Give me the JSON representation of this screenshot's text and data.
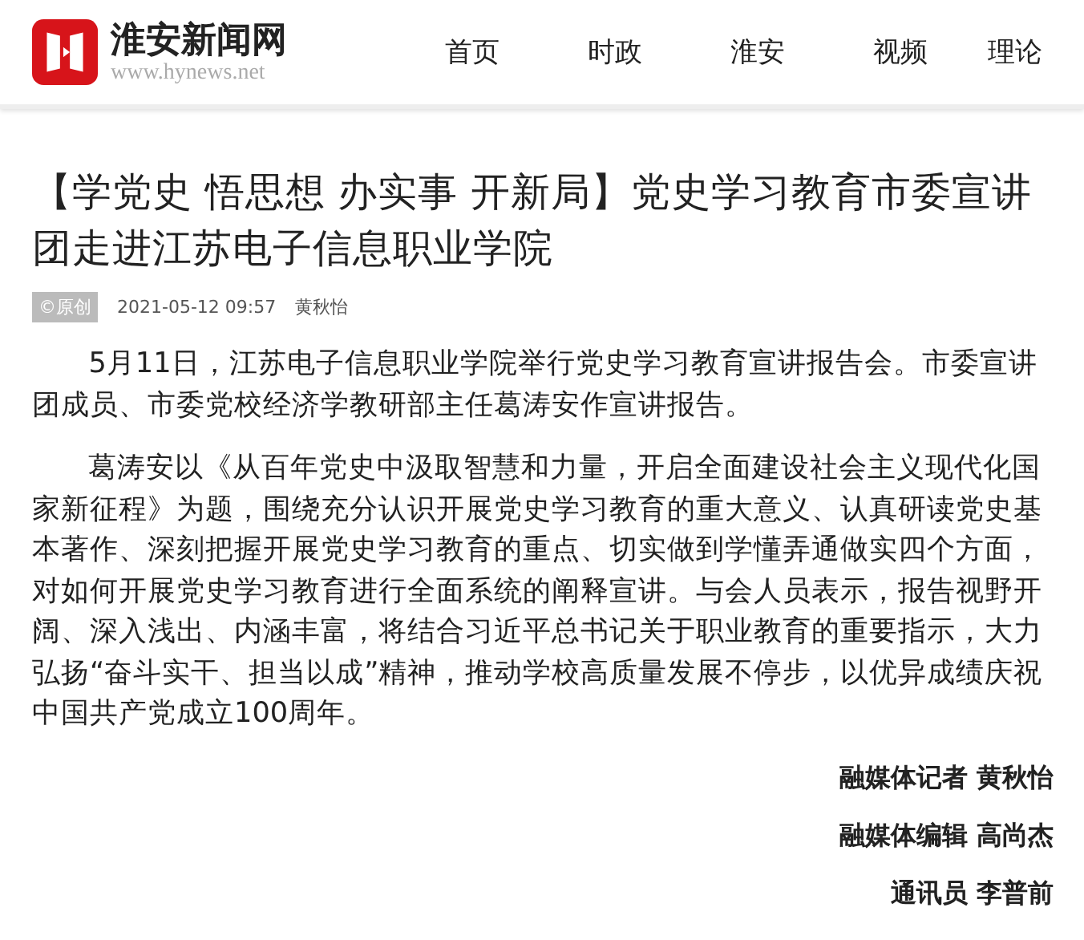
{
  "header": {
    "site_name": "淮安新闻网",
    "site_url": "www.hynews.net",
    "nav": [
      {
        "label": "首页"
      },
      {
        "label": "时政"
      },
      {
        "label": "淮安"
      },
      {
        "label": "视频"
      },
      {
        "label": "理论"
      }
    ]
  },
  "article": {
    "title": "【学党史 悟思想 办实事 开新局】党史学习教育市委宣讲团走进江苏电子信息职业学院",
    "badge": "©原创",
    "date": "2021-05-12 09:57",
    "author": "黄秋怡",
    "paragraphs": [
      "5月11日，江苏电子信息职业学院举行党史学习教育宣讲报告会。市委宣讲团成员、市委党校经济学教研部主任葛涛安作宣讲报告。",
      "葛涛安以《从百年党史中汲取智慧和力量，开启全面建设社会主义现代化国家新征程》为题，围绕充分认识开展党史学习教育的重大意义、认真研读党史基本著作、深刻把握开展党史学习教育的重点、切实做到学懂弄通做实四个方面，对如何开展党史学习教育进行全面系统的阐释宣讲。与会人员表示，报告视野开阔、深入浅出、内涵丰富，将结合习近平总书记关于职业教育的重要指示，大力弘扬“奋斗实干、担当以成”精神，推动学校高质量发展不停步，以优异成绩庆祝中国共产党成立100周年。"
    ],
    "credits": [
      "融媒体记者 黄秋怡",
      "融媒体编辑 高尚杰",
      "通讯员 李普前"
    ]
  }
}
